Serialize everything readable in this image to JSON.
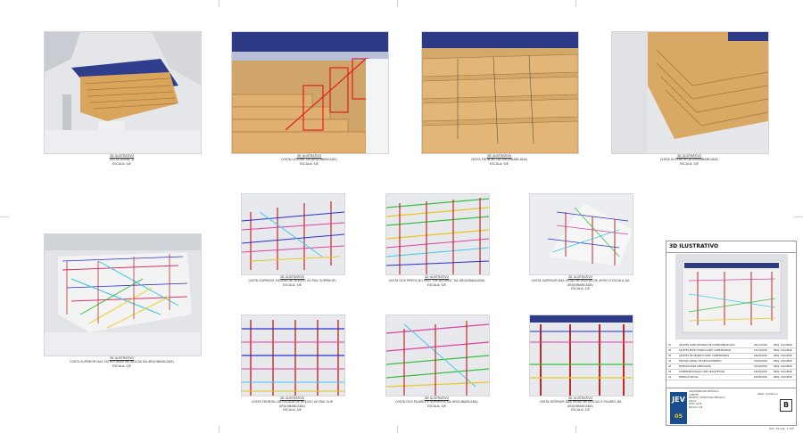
{
  "views": [
    {
      "title": "3D ILUSTRATIVO",
      "desc": "(VISTA GERAL 3)",
      "scale": "ESCALA: S/E"
    },
    {
      "title": "3D ILUSTRATIVO",
      "desc": "(VISTA LATERAL DA ARQUIBANCADA)",
      "scale": "ESCALA: S/E"
    },
    {
      "title": "3D ILUSTRATIVO",
      "desc": "(VISTA FRONTAL DA ARQUIBANCADA)",
      "scale": "ESCALA: S/E"
    },
    {
      "title": "3D ILUSTRATIVO",
      "desc": "(VISTA SUPERIOR DA ARQUIBANCADA)",
      "scale": "ESCALA: S/E"
    },
    {
      "title": "3D ILUSTRATIVO",
      "desc": "(VISTA SUPERIOR DAS ESTRUTURAS METÁLICAS DA ARQUIBANCADA)",
      "scale": "ESCALA: S/E"
    },
    {
      "title": "3D ILUSTRATIVO",
      "desc": "(VISTA SUPERIOR ESCADA DE ACESSO AO PAV. SUPERIOR)",
      "scale": "ESCALA: S/E"
    },
    {
      "title": "3D ILUSTRATIVO",
      "desc": "(VISTA DOS PERFIS DO PISO \"EM DEGRAU\" DA ARQUIBANCADA)",
      "scale": "ESCALA: S/E"
    },
    {
      "title": "3D ILUSTRATIVO",
      "desc": "(VISTA SUPERIOR DAS VIGAS METÁLICAS DE APOIO E ESCALA DA ARQUIBANCADA)",
      "scale": "ESCALA: S/E"
    },
    {
      "title": "3D ILUSTRATIVO",
      "desc": "(VISTA FRONTAL DA ESCADA DE ACESSO AO PAV. SUP. ARQUIBANCADA)",
      "scale": "ESCALA: S/E"
    },
    {
      "title": "3D ILUSTRATIVO",
      "desc": "(VISTA DOS PILARES E SUPORTES DA ARQUIBANCADA)",
      "scale": "ESCALA: S/E"
    },
    {
      "title": "3D ILUSTRATIVO",
      "desc": "(VISTA INTERIOR DAS VIGAS METÁLICAS E PILARES DA ARQUIBANCADA)",
      "scale": "ESCALA: S/E"
    }
  ],
  "title_block": {
    "header": "3D ILUSTRATIVO",
    "revisions": [
      {
        "no": "07",
        "desc": "AJUSTES CONF. REUNIÃO DE COMPATIBILIZAÇÃO",
        "date": "28/11/2016",
        "by": "PROJ. COLABOR."
      },
      {
        "no": "06",
        "desc": "AJUSTES ESTRUTURAIS CONF. COMENTÁRIOS",
        "date": "10/10/2016",
        "by": "PROJ. COLABOR."
      },
      {
        "no": "05",
        "desc": "AJUSTES DE PROJETO CONF. COMENTÁRIOS",
        "date": "29/09/2016",
        "by": "PROJ. COLABOR."
      },
      {
        "no": "04",
        "desc": "REVISÃO GERAL DE DETALHAMENTO",
        "date": "15/09/2016",
        "by": "PROJ. COLABOR."
      },
      {
        "no": "03",
        "desc": "EMISSÃO PARA APROVAÇÃO",
        "date": "01/09/2016",
        "by": "PROJ. COLABOR."
      },
      {
        "no": "02",
        "desc": "COMPATIBILIZAÇÃO COM ARQUITETURA",
        "date": "18/08/2016",
        "by": "PROJ. COLABOR."
      },
      {
        "no": "01",
        "desc": "EMISSÃO INICIAL",
        "date": "04/08/2016",
        "by": "PROJ. COLABOR."
      }
    ],
    "logo_main": "JEV",
    "logo_sub": "05",
    "fields": [
      "ARQUIBANCADA METÁLICA",
      "CLIENTE:",
      "PROJETO: ESTRUTURA METÁLICA",
      "LOCAL:",
      "DATA: 2016",
      "ESCALA: S/E"
    ],
    "arch_label": "atlier (colabor.)",
    "sheet_no": "B"
  },
  "footnote": "Ref.: Escala: 1:100"
}
